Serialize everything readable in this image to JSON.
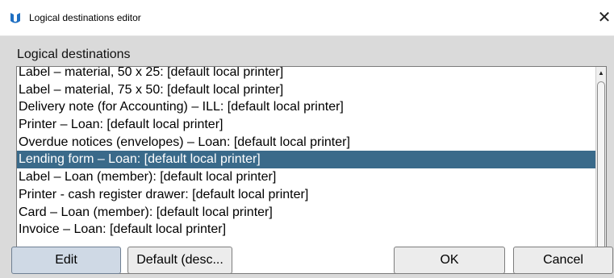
{
  "window": {
    "title": "Logical destinations editor",
    "close_symbol": "✕"
  },
  "section": {
    "label": "Logical destinations"
  },
  "list": {
    "items": [
      "Label – material, 50 x 25: [default local printer]",
      "Label – material, 75 x 50: [default local printer]",
      "Delivery note (for Accounting) – ILL: [default local printer]",
      "Printer – Loan: [default local printer]",
      "Overdue notices (envelopes) – Loan: [default local printer]",
      "Lending form – Loan: [default local printer]",
      "Label – Loan (member): [default local printer]",
      "Printer - cash register drawer: [default local printer]",
      "Card – Loan (member): [default local printer]",
      "Invoice – Loan: [default local printer]"
    ],
    "selected_index": 5
  },
  "scrollbar": {
    "up": "▲",
    "down": "▼"
  },
  "buttons": {
    "edit": "Edit",
    "default": "Default (desc...",
    "ok": "OK",
    "cancel": "Cancel"
  },
  "colors": {
    "selection": "#3a6a8a",
    "icon": "#1f6fc2",
    "dialog_bg": "#dadada"
  }
}
